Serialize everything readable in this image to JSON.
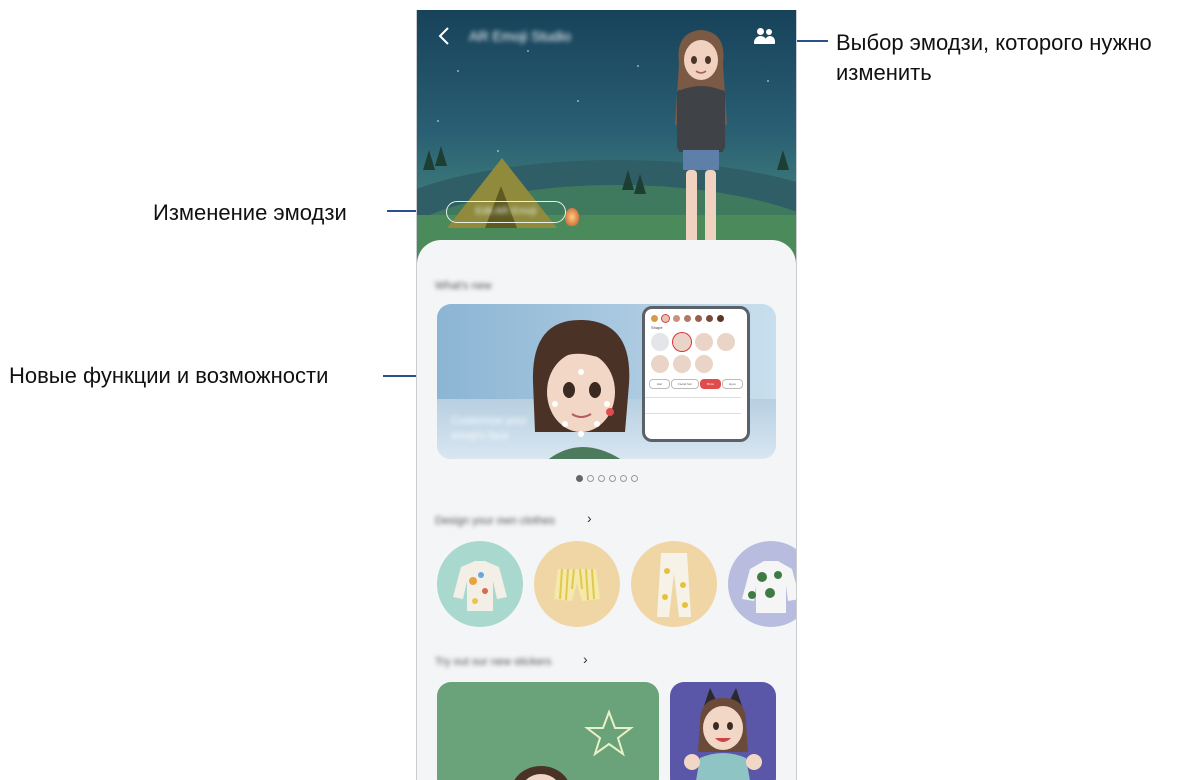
{
  "callouts": {
    "switch_emoji": "Выбор эмодзи, которого нужно изменить",
    "edit_emoji": "Изменение эмодзи",
    "whats_new": "Новые функции и возможности"
  },
  "app": {
    "title": "AR Emoji Studio",
    "edit_button": "Edit AR Emoji",
    "back_icon": "chevron-left-icon",
    "switch_icon": "people-icon"
  },
  "whats_new": {
    "heading": "What's new",
    "card_caption": "Customize your emoji's face",
    "page_count": 6,
    "active_page": 1,
    "mockup": {
      "label": "Shape",
      "chips": [
        "Hair",
        "Facial hair",
        "Brow",
        "Eyes"
      ]
    }
  },
  "design_stickers": {
    "heading": "Design your own clothes",
    "items": [
      "longsleeve",
      "shorts",
      "pants",
      "shirt"
    ]
  },
  "try_stickers": {
    "heading": "Try out our new stickers"
  },
  "colors": {
    "accent_line": "#2b4f8f",
    "sheet_bg": "#f4f5f7"
  }
}
